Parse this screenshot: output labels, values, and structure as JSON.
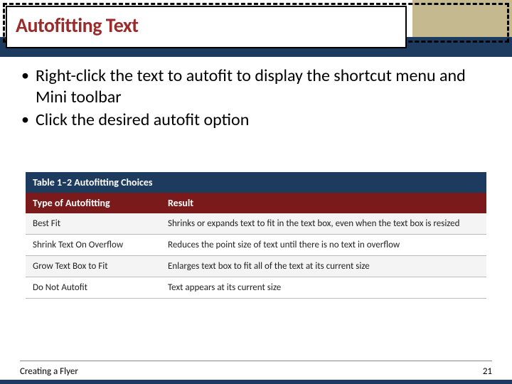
{
  "title": "Autofitting Text",
  "bullets": [
    "Right-click the text to autofit to display the shortcut menu and Mini toolbar",
    "Click the desired autofit option"
  ],
  "table": {
    "caption": "Table 1–2 Autofitting Choices",
    "headers": {
      "col1": "Type of Autofitting",
      "col2": "Result"
    },
    "rows": [
      {
        "col1": "Best Fit",
        "col2": "Shrinks or expands text to fit in the text box, even when the text box is resized"
      },
      {
        "col1": "Shrink Text On Overflow",
        "col2": "Reduces the point size of text until there is no text in overflow"
      },
      {
        "col1": "Grow Text Box to Fit",
        "col2": "Enlarges text box to fit all of the text at its current size"
      },
      {
        "col1": "Do Not Autofit",
        "col2": "Text appears at its current size"
      }
    ]
  },
  "footer": {
    "left": "Creating a Flyer",
    "right": "21"
  }
}
